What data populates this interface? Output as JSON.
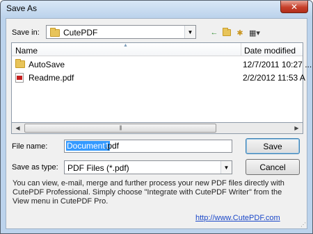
{
  "window": {
    "title": "Save As",
    "close_glyph": "✕"
  },
  "save_in": {
    "label": "Save in:",
    "value": "CutePDF"
  },
  "toolbar": {
    "back_icon": "←",
    "up_icon": "↑",
    "new_folder_icon": "✱",
    "views_icon": "▦▾"
  },
  "list": {
    "columns": {
      "name": "Name",
      "date": "Date modified",
      "sort_glyph": "▲"
    },
    "rows": [
      {
        "name": "AutoSave",
        "date": "12/7/2011 10:27 ...",
        "type": "folder"
      },
      {
        "name": "Readme.pdf",
        "date": "2/2/2012 11:53 A",
        "type": "pdf"
      }
    ]
  },
  "scrollbar": {
    "left": "◀",
    "right": "▶",
    "grip": "|||"
  },
  "file_name": {
    "label": "File name:",
    "selected": "Document1",
    "suffix": ".pdf"
  },
  "save_as_type": {
    "label": "Save as type:",
    "value": "PDF Files (*.pdf)"
  },
  "buttons": {
    "save": "Save",
    "cancel": "Cancel"
  },
  "info_text": "You can view, e-mail, merge and further process your new PDF files directly with CutePDF Professional. Simply choose \"Integrate with CutePDF Writer\" from the View menu in CutePDF Pro.",
  "link_text": "http://www.CutePDF.com",
  "colors": {
    "accent": "#3399ff",
    "link": "#1a47c8",
    "close": "#c7402b"
  }
}
